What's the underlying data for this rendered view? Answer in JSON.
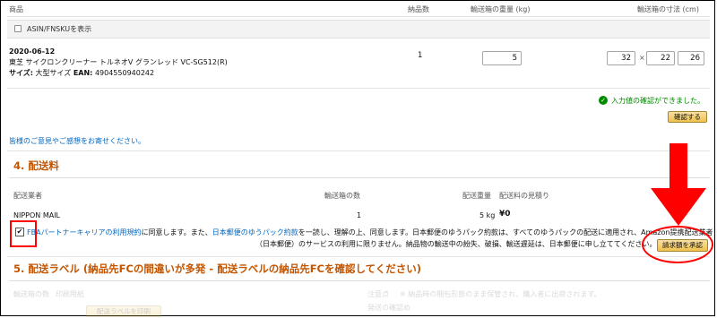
{
  "table_header": {
    "product": "商品",
    "quantity": "納品数",
    "weight": "輸送箱の重量 (kg)",
    "dimensions": "輸送箱の寸法 (cm)"
  },
  "asin_toggle": {
    "label": "ASIN/FNSKUを表示"
  },
  "item": {
    "date": "2020-06-12",
    "name": "東芝 サイクロンクリーナー トルネオV グランレッド VC-SG512(R)",
    "size_prefix": "サイズ:",
    "size_value": "大型サイズ",
    "ean_label": "EAN:",
    "ean_value": "4904550940242",
    "quantity": "1",
    "weight": "5",
    "dim_l": "32",
    "dim_w": "22",
    "dim_h": "26",
    "times": "×"
  },
  "confirmation": {
    "message": "入力値の確認ができました。",
    "confirm_button": "確認する"
  },
  "feedback_link": "皆様のご意見やご感想をお寄せください。",
  "section4": {
    "title": "4. 配送料",
    "col_carrier": "配送業者",
    "col_boxes": "輸送箱の数",
    "col_weight": "配送重量",
    "col_estimate": "配送料の見積り",
    "carrier": "NIPPON MAIL",
    "boxes": "1",
    "weight": "5 kg",
    "estimate": "¥0",
    "agreement_link1": "FBAパートナーキャリアの利用規約",
    "agreement_text1": "に同意します。また、",
    "agreement_link2": "日本郵便のゆうパック約款",
    "agreement_text2": "を一読し、理解の上、同意します。日本郵便のゆうパック約款は、すべてのゆうパックの配送に適用され、Amazon提携配送業者",
    "agreement_line2": "（日本郵便）のサービスの利用に限りません。納品物の輸送中の紛失、破損、輸送遅延は、日本郵便に申し立ててください。",
    "approve_button": "請求額を承認"
  },
  "section5": {
    "title": "5. 配送ラベル (納品先FCの間違いが多発 - 配送ラベルの納品先FCを確認してください)",
    "col_boxes": "輸送箱の数",
    "col_paper": "印刷用紙",
    "print_button": "配送ラベルを印刷",
    "note_label": "注意点",
    "note_text": "※ 納品時の梱包形態のまま保管され、購入者に出荷されます。",
    "note_line2": "発送の確認め"
  },
  "colors": {
    "accent": "#c45500",
    "link": "#0066c0",
    "success": "#008a00",
    "annotation": "#ff0000",
    "button": "#f0c14b"
  }
}
